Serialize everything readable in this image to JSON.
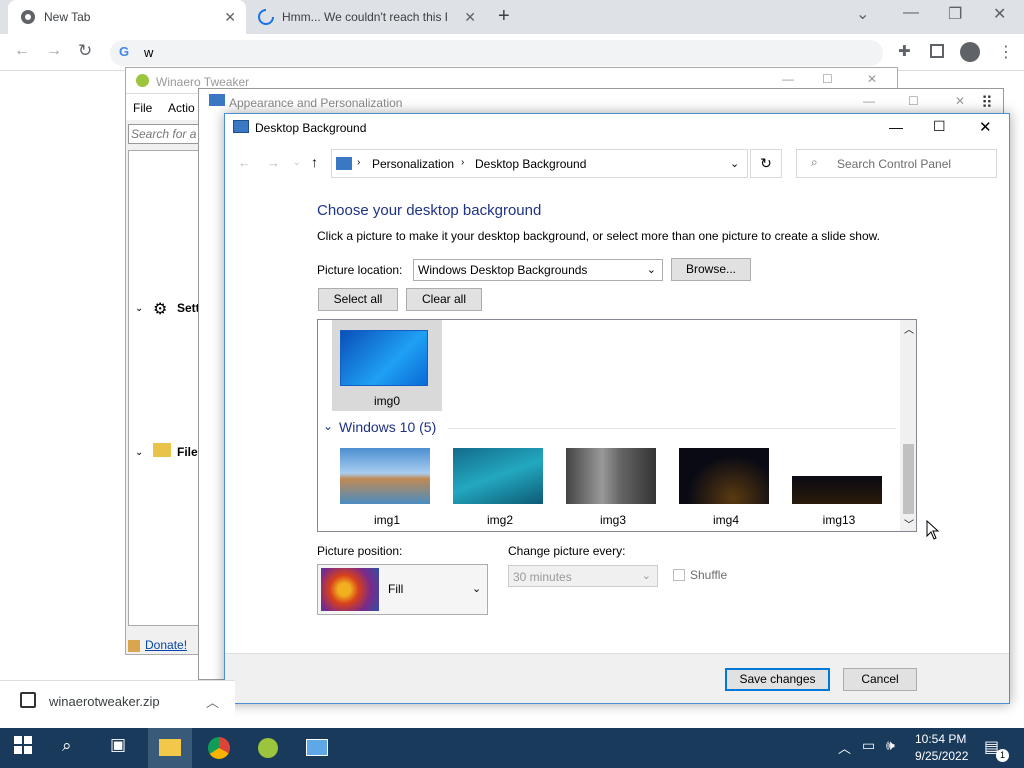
{
  "browser": {
    "tabs": [
      {
        "label": "New Tab"
      },
      {
        "label": "Hmm... We couldn't reach this Re"
      }
    ],
    "omnibox_value": "w"
  },
  "winaero": {
    "title": "Winaero Tweaker",
    "menu": [
      "File",
      "Actio"
    ],
    "search_placeholder": "Search for a t",
    "tree": [
      "Sett",
      "File"
    ],
    "donate": "Donate!"
  },
  "appearance": {
    "title": "Appearance and Personalization"
  },
  "dialog": {
    "title": "Desktop Background",
    "breadcrumb": [
      "Personalization",
      "Desktop Background"
    ],
    "search_placeholder": "Search Control Panel",
    "heading": "Choose your desktop background",
    "description": "Click a picture to make it your desktop background, or select more than one picture to create a slide show.",
    "picture_location_label": "Picture location:",
    "picture_location_value": "Windows Desktop Backgrounds",
    "browse_label": "Browse...",
    "select_all_label": "Select all",
    "clear_all_label": "Clear all",
    "top_image": "img0",
    "group_label": "Windows 10 (5)",
    "images": [
      "img1",
      "img2",
      "img3",
      "img4",
      "img13"
    ],
    "position_label": "Picture position:",
    "position_value": "Fill",
    "change_label": "Change picture every:",
    "change_value": "30 minutes",
    "shuffle_label": "Shuffle",
    "save_label": "Save changes",
    "cancel_label": "Cancel"
  },
  "download": {
    "filename": "winaerotweaker.zip"
  },
  "taskbar": {
    "time": "10:54 PM",
    "date": "9/25/2022",
    "notif_count": "1"
  },
  "colors": {
    "accent": "#0078d7",
    "heading": "#1e3287",
    "taskbar": "#1a3a5c"
  }
}
